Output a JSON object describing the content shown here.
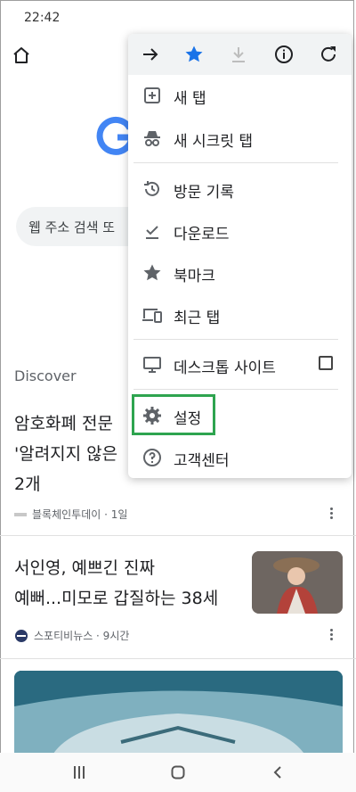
{
  "status_bar": {
    "time": "22:42"
  },
  "page": {
    "search_placeholder": "웹 주소 검색 또",
    "discover_label": "Discover"
  },
  "feed": [
    {
      "title_lines": [
        "암호화폐 전문",
        "'알려지지 않은",
        "2개"
      ],
      "source": "블록체인투데이 · 1일"
    },
    {
      "title_lines": [
        "서인영, 예쁘긴 진짜",
        "예뻐...미모로 갑질하는 38세"
      ],
      "source": "스포티비뉴스 · 9시간"
    }
  ],
  "menu": {
    "toolbar": [
      "forward-icon",
      "bookmark-star-icon",
      "download-icon",
      "info-icon",
      "refresh-icon"
    ],
    "items": [
      {
        "label": "새 탭",
        "icon": "new-tab-icon"
      },
      {
        "label": "새 시크릿 탭",
        "icon": "incognito-icon"
      },
      {
        "label": "방문 기록",
        "icon": "history-icon"
      },
      {
        "label": "다운로드",
        "icon": "download-check-icon"
      },
      {
        "label": "북마크",
        "icon": "star-icon"
      },
      {
        "label": "최근 탭",
        "icon": "devices-icon"
      },
      {
        "label": "데스크톱 사이트",
        "icon": "desktop-icon",
        "checked": false
      },
      {
        "label": "설정",
        "icon": "gear-icon",
        "highlighted": true
      },
      {
        "label": "고객센터",
        "icon": "help-icon"
      }
    ]
  },
  "colors": {
    "accent_blue": "#1a73e8",
    "highlight_green": "#2ea44f"
  }
}
